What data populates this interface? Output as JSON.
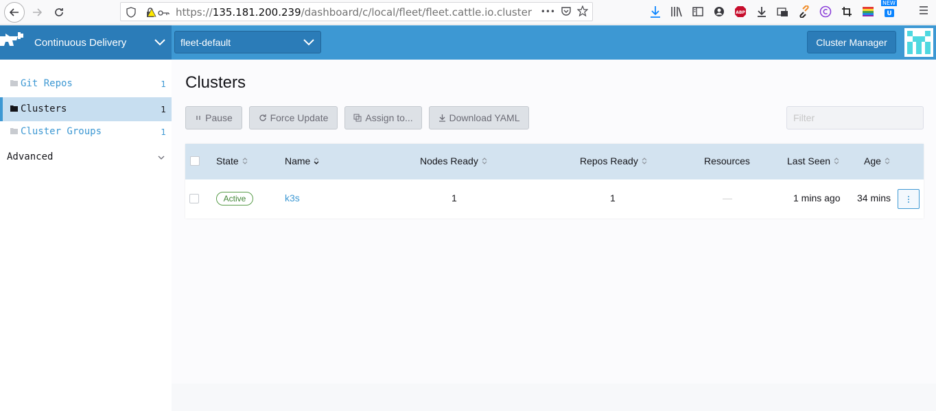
{
  "browser": {
    "url_prefix": "https://",
    "url_host": "135.181.200.239",
    "url_path": "/dashboard/c/local/fleet/fleet.cattle.io.cluster",
    "more": "•••",
    "new_badge": "NEW"
  },
  "header": {
    "product": "Continuous Delivery",
    "workspace": "fleet-default",
    "cluster_manager_label": "Cluster Manager"
  },
  "sidebar": {
    "items": [
      {
        "label": "Git Repos",
        "count": "1"
      },
      {
        "label": "Clusters",
        "count": "1"
      },
      {
        "label": "Cluster Groups",
        "count": "1"
      }
    ],
    "advanced_label": "Advanced"
  },
  "main": {
    "title": "Clusters",
    "actions": {
      "pause": "Pause",
      "force_update": "Force Update",
      "assign_to": "Assign to...",
      "download_yaml": "Download YAML"
    },
    "filter_placeholder": "Filter"
  },
  "table": {
    "columns": [
      "State",
      "Name",
      "Nodes Ready",
      "Repos Ready",
      "Resources",
      "Last Seen",
      "Age"
    ],
    "rows": [
      {
        "state": "Active",
        "name": "k3s",
        "nodes_ready": "1",
        "repos_ready": "1",
        "resources": "—",
        "last_seen": "1 mins ago",
        "age": "34 mins"
      }
    ]
  },
  "colors": {
    "accent": "#3d98d3",
    "header_dark": "#2b7cb8",
    "active_green": "#5a9d4b"
  }
}
